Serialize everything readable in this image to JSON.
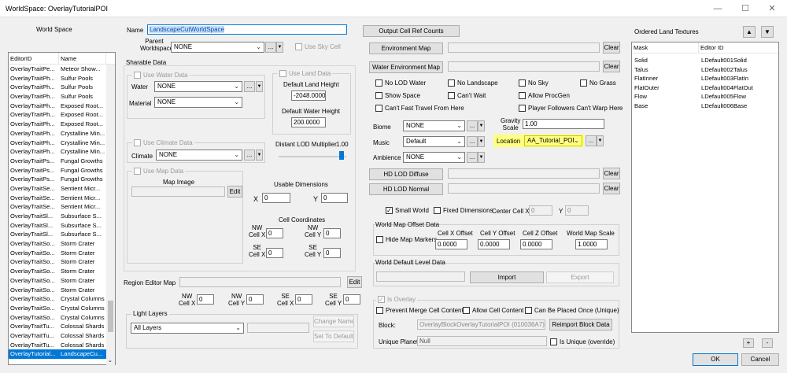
{
  "window": {
    "title": "WorldSpace: OverlayTutorialPOI",
    "minimize": "—",
    "maximize": "☐",
    "close": "✕"
  },
  "left_panel": {
    "title": "World Space",
    "col_editorid": "EditorID",
    "col_name": "Name",
    "rows": [
      [
        "OverlayTraitPe...",
        "Meteor Show..."
      ],
      [
        "OverlayTraitPh...",
        "Sulfur Pools"
      ],
      [
        "OverlayTraitPh...",
        "Sulfur Pools"
      ],
      [
        "OverlayTraitPh...",
        "Sulfur Pools"
      ],
      [
        "OverlayTraitPh...",
        "Exposed Root..."
      ],
      [
        "OverlayTraitPh...",
        "Exposed Root..."
      ],
      [
        "OverlayTraitPh...",
        "Exposed Root..."
      ],
      [
        "OverlayTraitPh...",
        "Crystalline Min..."
      ],
      [
        "OverlayTraitPh...",
        "Crystalline Min..."
      ],
      [
        "OverlayTraitPh...",
        "Crystalline Min..."
      ],
      [
        "OverlayTraitPs...",
        "Fungal Growths"
      ],
      [
        "OverlayTraitPs...",
        "Fungal Growths"
      ],
      [
        "OverlayTraitPs...",
        "Fungal Growths"
      ],
      [
        "OverlayTraitSe...",
        "Sentient Micr..."
      ],
      [
        "OverlayTraitSe...",
        "Sentient Micr..."
      ],
      [
        "OverlayTraitSe...",
        "Sentient Micr..."
      ],
      [
        "OverlayTraitSl...",
        "Subsurface S..."
      ],
      [
        "OverlayTraitSl...",
        "Subsurface S..."
      ],
      [
        "OverlayTraitSl...",
        "Subsurface S..."
      ],
      [
        "OverlayTraitSo...",
        "Storm Crater"
      ],
      [
        "OverlayTraitSo...",
        "Storm Crater"
      ],
      [
        "OverlayTraitSo...",
        "Storm Crater"
      ],
      [
        "OverlayTraitSo...",
        "Storm Crater"
      ],
      [
        "OverlayTraitSo...",
        "Storm Crater"
      ],
      [
        "OverlayTraitSo...",
        "Storm Crater"
      ],
      [
        "OverlayTraitSo...",
        "Crystal Columns"
      ],
      [
        "OverlayTraitSo...",
        "Crystal Columns"
      ],
      [
        "OverlayTraitSo...",
        "Crystal Columns"
      ],
      [
        "OverlayTraitTu...",
        "Colossal Shards"
      ],
      [
        "OverlayTraitTu...",
        "Colossal Shards"
      ],
      [
        "OverlayTraitTu...",
        "Colossal Shards"
      ],
      [
        "OverlayTutorial...",
        "LandscapeCu..."
      ]
    ]
  },
  "name": {
    "label": "Name",
    "value": "LandscapeCutWorldSpace"
  },
  "parent": {
    "label1": "Parent",
    "label2": "Worldspace",
    "value": "NONE",
    "use_sky_cell": "Use Sky Cell"
  },
  "sharable": {
    "title": "Sharable Data",
    "water": {
      "check": "Use Water Data",
      "water_label": "Water",
      "water_value": "NONE",
      "material_label": "Material",
      "material_value": "NONE"
    },
    "land": {
      "check": "Use Land Data",
      "default_land_height_label": "Default Land Height",
      "default_land_height": "-2048.0000",
      "default_water_height_label": "Default Water Height",
      "default_water_height": "200.0000"
    },
    "climate": {
      "check": "Use Climate Data",
      "label": "Climate",
      "value": "NONE"
    },
    "lod": {
      "label": "Distant LOD Multiplier",
      "value": "1.00"
    },
    "map": {
      "check": "Use Map Data",
      "image_label": "Map Image",
      "edit": "Edit",
      "usable_dim": "Usable Dimensions",
      "x_label": "X",
      "x": "0",
      "y_label": "Y",
      "y": "0",
      "cell_coords": "Cell Coordinates",
      "nw_x_label1": "NW",
      "nw_x_label2": "Cell X",
      "nw_x": "0",
      "nw_y_label1": "NW",
      "nw_y_label2": "Cell Y",
      "nw_y": "0",
      "se_x_label1": "SE",
      "se_x_label2": "Cell X",
      "se_x": "0",
      "se_y_label1": "SE",
      "se_y_label2": "Cell Y",
      "se_y": "0"
    }
  },
  "region": {
    "label": "Region Editor Map",
    "edit": "Edit",
    "nw_x_label1": "NW",
    "nw_x_label2": "Cell X",
    "nw_x": "0",
    "nw_y_label1": "NW",
    "nw_y_label2": "Cell Y",
    "nw_y": "0",
    "se_x_label1": "SE",
    "se_x_label2": "Cell X",
    "se_x": "0",
    "se_y_label1": "SE",
    "se_y_label2": "Cell Y",
    "se_y": "0"
  },
  "light": {
    "title": "Light Layers",
    "value": "All Layers",
    "change": "Change Name",
    "set_default": "Set To Default"
  },
  "middle": {
    "output_btn": "Output Cell Ref Counts",
    "env_map": "Environment Map",
    "env_clear": "Clear",
    "water_env_map": "Water Environment Map",
    "water_env_clear": "Clear",
    "checks": [
      "No LOD Water",
      "No Landscape",
      "No Sky",
      "No Grass",
      "Show Space",
      "Can't Wait",
      "Allow ProcGen",
      "Can't Fast Travel From Here",
      "Player Followers Can't Warp  Here"
    ],
    "biome_label": "Biome",
    "biome_value": "NONE",
    "gravity_label1": "Gravity",
    "gravity_label2": "Scale",
    "gravity_value": "1.00",
    "music_label": "Music",
    "music_value": "Default",
    "location_label": "Location",
    "location_value": "AA_Tutorial_POI",
    "ambience_label": "Ambience",
    "ambience_value": "NONE",
    "hd_lod_diffuse": "HD LOD Diffuse",
    "hd_diffuse_clear": "Clear",
    "hd_lod_normal": "HD LOD Normal",
    "hd_normal_clear": "Clear",
    "small_world": "Small World",
    "fixed_dim": "Fixed Dimensions",
    "center_cell": "Center Cell X",
    "cc_x": "0",
    "cc_y_label": "Y",
    "cc_y": "0",
    "offset_title": "World Map Offset Data",
    "hide_markers": "Hide Map Markers",
    "cell_x_offset_label1": "Cell X Offset",
    "cell_x_offset": "0.0000",
    "cell_y_offset_label1": "Cell Y Offset",
    "cell_y_offset": "0.0000",
    "cell_z_offset_label1": "Cell Z Offset",
    "cell_z_offset": "0.0000",
    "map_scale_label": "World Map Scale",
    "map_scale": "1.0000",
    "level_title": "World Default Level Data",
    "import": "Import",
    "export": "Export",
    "is_overlay": "Is Overlay",
    "prevent_merge": "Prevent Merge Cell Content",
    "allow_cell": "Allow Cell Content",
    "placed_once": "Can Be Placed Once (Unique)",
    "block_label": "Block:",
    "block_value": "OverlayBlockOverlayTutorialPOI (010036A7)",
    "reimport": "Reimport Block Data",
    "unique_label": "Unique Planet:",
    "unique_value": "Null",
    "is_unique": "Is Unique (override)"
  },
  "right": {
    "title": "Ordered Land Textures",
    "up": "▲",
    "down": "▼",
    "col_mask": "Mask",
    "col_editor": "Editor ID",
    "rows": [
      [
        "Solid",
        "LDefault001Solid"
      ],
      [
        "Talus",
        "LDefault002Talus"
      ],
      [
        "FlatInner",
        "LDefault003FlatIn"
      ],
      [
        "FlatOuter",
        "LDefault004FlatOut"
      ],
      [
        "Flow",
        "LDefault005Flow"
      ],
      [
        "Base",
        "LDefault006Base"
      ]
    ],
    "plus": "+",
    "minus": "-",
    "ok": "OK",
    "cancel": "Cancel"
  },
  "colors": {
    "selection": "#0078d7",
    "highlight": "#ffff80",
    "name_highlight": "#c6e0ff"
  }
}
